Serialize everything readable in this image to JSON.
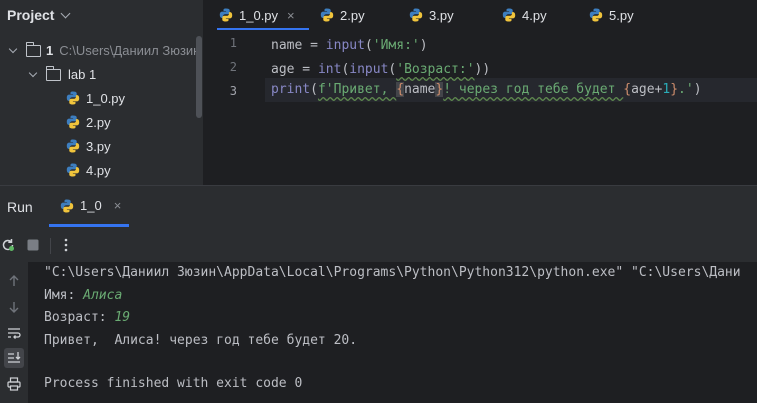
{
  "project": {
    "title": "Project",
    "root": {
      "number": "1",
      "path": "C:\\Users\\Даниил Зюзин"
    },
    "folder": "lab 1",
    "files": [
      "1_0.py",
      "2.py",
      "3.py",
      "4.py"
    ]
  },
  "editor": {
    "tabs": [
      {
        "label": "1_0.py",
        "active": true,
        "closable": true
      },
      {
        "label": "2.py"
      },
      {
        "label": "3.py"
      },
      {
        "label": "4.py"
      },
      {
        "label": "5.py"
      }
    ],
    "line_numbers": [
      "1",
      "2",
      "3"
    ],
    "current_line": 3,
    "code": {
      "l1": {
        "a": "name = ",
        "fn": "input",
        "b": "(",
        "s": "'Имя:'",
        "c": ")"
      },
      "l2": {
        "a": "age = ",
        "fn1": "int",
        "b": "(",
        "fn2": "input",
        "c": "(",
        "s": "'Возраст:'",
        "d": "))"
      },
      "l3": {
        "fn": "print",
        "open": "(",
        "prefix": "f'Привет, ",
        "brace1_open": "{",
        "var1": "name",
        "brace1_close": "}",
        "mid": "! через год тебе будет ",
        "brace2_open": "{",
        "var2": "age+",
        "num": "1",
        "brace2_close": "}",
        "end": ".'",
        "close": ")"
      }
    }
  },
  "run": {
    "label": "Run",
    "tab": {
      "label": "1_0",
      "close": "×"
    }
  },
  "console": {
    "command": "\"C:\\Users\\Даниил Зюзин\\AppData\\Local\\Programs\\Python\\Python312\\python.exe\" \"C:\\Users\\Дани",
    "prompt1": "Имя: ",
    "input1": "Алиса",
    "prompt2": "Возраст: ",
    "input2": "19",
    "result": "Привет,  Алиса! через год тебе будет 20.",
    "exit": "Process finished with exit code 0"
  },
  "icons": {
    "python_blue": "#3d7ebf",
    "python_yellow": "#f0c43c"
  },
  "colors": {
    "accent": "#3574f0",
    "string": "#6aab73",
    "builtin": "#8888c6",
    "fstring_brace": "#cf8e6d",
    "number": "#2aacb8"
  }
}
